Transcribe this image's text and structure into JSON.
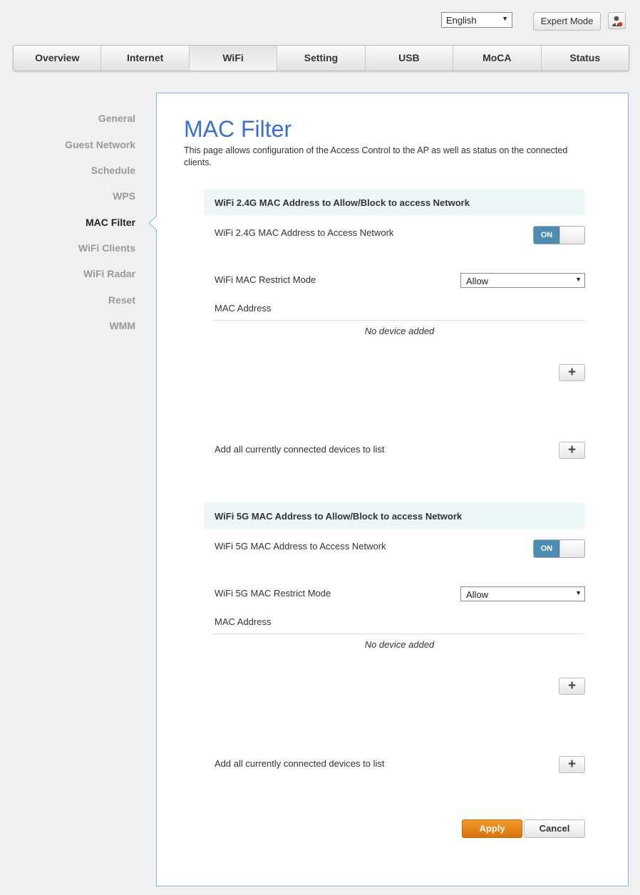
{
  "header": {
    "language": "English",
    "expert_mode_label": "Expert Mode",
    "user_icon": "user-admin-icon"
  },
  "nav": {
    "tabs": [
      "Overview",
      "Internet",
      "WiFi",
      "Setting",
      "USB",
      "MoCA",
      "Status"
    ],
    "active": "WiFi"
  },
  "sidebar": {
    "items": [
      "General",
      "Guest Network",
      "Schedule",
      "WPS",
      "MAC Filter",
      "WiFi Clients",
      "WiFi Radar",
      "Reset",
      "WMM"
    ],
    "active": "MAC Filter"
  },
  "page": {
    "title": "MAC Filter",
    "description": "This page allows configuration of the Access Control to the AP as well as status on the connected clients."
  },
  "section24": {
    "heading": "WiFi 2.4G MAC Address to Allow/Block to access Network",
    "access_label": "WiFi 2.4G MAC Address to Access Network",
    "toggle_state": "ON",
    "restrict_label": "WiFi MAC Restrict Mode",
    "restrict_value": "Allow",
    "mac_header": "MAC Address",
    "empty_message": "No device added",
    "add_all_label": "Add all currently connected devices to list",
    "add_icon": "plus-icon"
  },
  "section5": {
    "heading": "WiFi 5G MAC Address to Allow/Block to access Network",
    "access_label": "WiFi 5G MAC Address to Access Network",
    "toggle_state": "ON",
    "restrict_label": "WiFi 5G MAC Restrict Mode",
    "restrict_value": "Allow",
    "mac_header": "MAC Address",
    "empty_message": "No device added",
    "add_all_label": "Add all currently connected devices to list",
    "add_icon": "plus-icon"
  },
  "actions": {
    "apply_label": "Apply",
    "cancel_label": "Cancel"
  },
  "colors": {
    "title": "#3a6fd8",
    "toggle_on": "#4b8db3",
    "apply": "#e8860f",
    "section_bg": "#eef7f8"
  }
}
